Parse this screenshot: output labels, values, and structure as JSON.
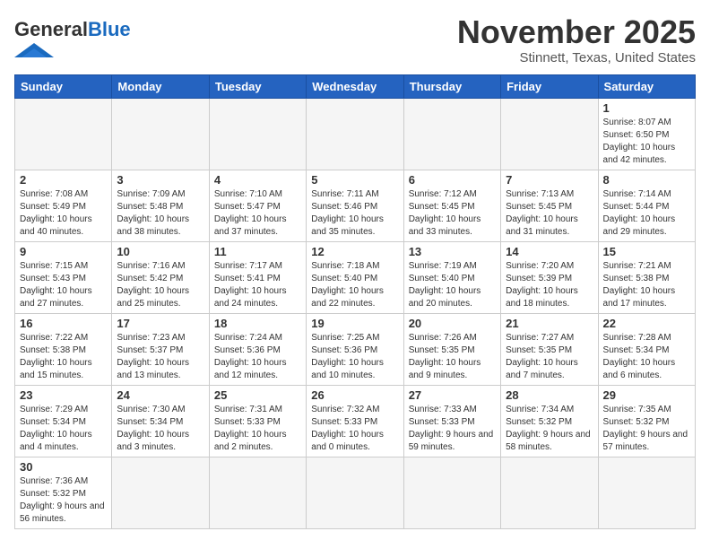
{
  "header": {
    "logo_general": "General",
    "logo_blue": "Blue",
    "title": "November 2025",
    "subtitle": "Stinnett, Texas, United States"
  },
  "days_of_week": [
    "Sunday",
    "Monday",
    "Tuesday",
    "Wednesday",
    "Thursday",
    "Friday",
    "Saturday"
  ],
  "weeks": [
    [
      {
        "day": "",
        "info": ""
      },
      {
        "day": "",
        "info": ""
      },
      {
        "day": "",
        "info": ""
      },
      {
        "day": "",
        "info": ""
      },
      {
        "day": "",
        "info": ""
      },
      {
        "day": "",
        "info": ""
      },
      {
        "day": "1",
        "info": "Sunrise: 8:07 AM\nSunset: 6:50 PM\nDaylight: 10 hours\nand 42 minutes."
      }
    ],
    [
      {
        "day": "2",
        "info": "Sunrise: 7:08 AM\nSunset: 5:49 PM\nDaylight: 10 hours\nand 40 minutes."
      },
      {
        "day": "3",
        "info": "Sunrise: 7:09 AM\nSunset: 5:48 PM\nDaylight: 10 hours\nand 38 minutes."
      },
      {
        "day": "4",
        "info": "Sunrise: 7:10 AM\nSunset: 5:47 PM\nDaylight: 10 hours\nand 37 minutes."
      },
      {
        "day": "5",
        "info": "Sunrise: 7:11 AM\nSunset: 5:46 PM\nDaylight: 10 hours\nand 35 minutes."
      },
      {
        "day": "6",
        "info": "Sunrise: 7:12 AM\nSunset: 5:45 PM\nDaylight: 10 hours\nand 33 minutes."
      },
      {
        "day": "7",
        "info": "Sunrise: 7:13 AM\nSunset: 5:45 PM\nDaylight: 10 hours\nand 31 minutes."
      },
      {
        "day": "8",
        "info": "Sunrise: 7:14 AM\nSunset: 5:44 PM\nDaylight: 10 hours\nand 29 minutes."
      }
    ],
    [
      {
        "day": "9",
        "info": "Sunrise: 7:15 AM\nSunset: 5:43 PM\nDaylight: 10 hours\nand 27 minutes."
      },
      {
        "day": "10",
        "info": "Sunrise: 7:16 AM\nSunset: 5:42 PM\nDaylight: 10 hours\nand 25 minutes."
      },
      {
        "day": "11",
        "info": "Sunrise: 7:17 AM\nSunset: 5:41 PM\nDaylight: 10 hours\nand 24 minutes."
      },
      {
        "day": "12",
        "info": "Sunrise: 7:18 AM\nSunset: 5:40 PM\nDaylight: 10 hours\nand 22 minutes."
      },
      {
        "day": "13",
        "info": "Sunrise: 7:19 AM\nSunset: 5:40 PM\nDaylight: 10 hours\nand 20 minutes."
      },
      {
        "day": "14",
        "info": "Sunrise: 7:20 AM\nSunset: 5:39 PM\nDaylight: 10 hours\nand 18 minutes."
      },
      {
        "day": "15",
        "info": "Sunrise: 7:21 AM\nSunset: 5:38 PM\nDaylight: 10 hours\nand 17 minutes."
      }
    ],
    [
      {
        "day": "16",
        "info": "Sunrise: 7:22 AM\nSunset: 5:38 PM\nDaylight: 10 hours\nand 15 minutes."
      },
      {
        "day": "17",
        "info": "Sunrise: 7:23 AM\nSunset: 5:37 PM\nDaylight: 10 hours\nand 13 minutes."
      },
      {
        "day": "18",
        "info": "Sunrise: 7:24 AM\nSunset: 5:36 PM\nDaylight: 10 hours\nand 12 minutes."
      },
      {
        "day": "19",
        "info": "Sunrise: 7:25 AM\nSunset: 5:36 PM\nDaylight: 10 hours\nand 10 minutes."
      },
      {
        "day": "20",
        "info": "Sunrise: 7:26 AM\nSunset: 5:35 PM\nDaylight: 10 hours\nand 9 minutes."
      },
      {
        "day": "21",
        "info": "Sunrise: 7:27 AM\nSunset: 5:35 PM\nDaylight: 10 hours\nand 7 minutes."
      },
      {
        "day": "22",
        "info": "Sunrise: 7:28 AM\nSunset: 5:34 PM\nDaylight: 10 hours\nand 6 minutes."
      }
    ],
    [
      {
        "day": "23",
        "info": "Sunrise: 7:29 AM\nSunset: 5:34 PM\nDaylight: 10 hours\nand 4 minutes."
      },
      {
        "day": "24",
        "info": "Sunrise: 7:30 AM\nSunset: 5:34 PM\nDaylight: 10 hours\nand 3 minutes."
      },
      {
        "day": "25",
        "info": "Sunrise: 7:31 AM\nSunset: 5:33 PM\nDaylight: 10 hours\nand 2 minutes."
      },
      {
        "day": "26",
        "info": "Sunrise: 7:32 AM\nSunset: 5:33 PM\nDaylight: 10 hours\nand 0 minutes."
      },
      {
        "day": "27",
        "info": "Sunrise: 7:33 AM\nSunset: 5:33 PM\nDaylight: 9 hours\nand 59 minutes."
      },
      {
        "day": "28",
        "info": "Sunrise: 7:34 AM\nSunset: 5:32 PM\nDaylight: 9 hours\nand 58 minutes."
      },
      {
        "day": "29",
        "info": "Sunrise: 7:35 AM\nSunset: 5:32 PM\nDaylight: 9 hours\nand 57 minutes."
      }
    ],
    [
      {
        "day": "30",
        "info": "Sunrise: 7:36 AM\nSunset: 5:32 PM\nDaylight: 9 hours\nand 56 minutes."
      },
      {
        "day": "",
        "info": ""
      },
      {
        "day": "",
        "info": ""
      },
      {
        "day": "",
        "info": ""
      },
      {
        "day": "",
        "info": ""
      },
      {
        "day": "",
        "info": ""
      },
      {
        "day": "",
        "info": ""
      }
    ]
  ]
}
